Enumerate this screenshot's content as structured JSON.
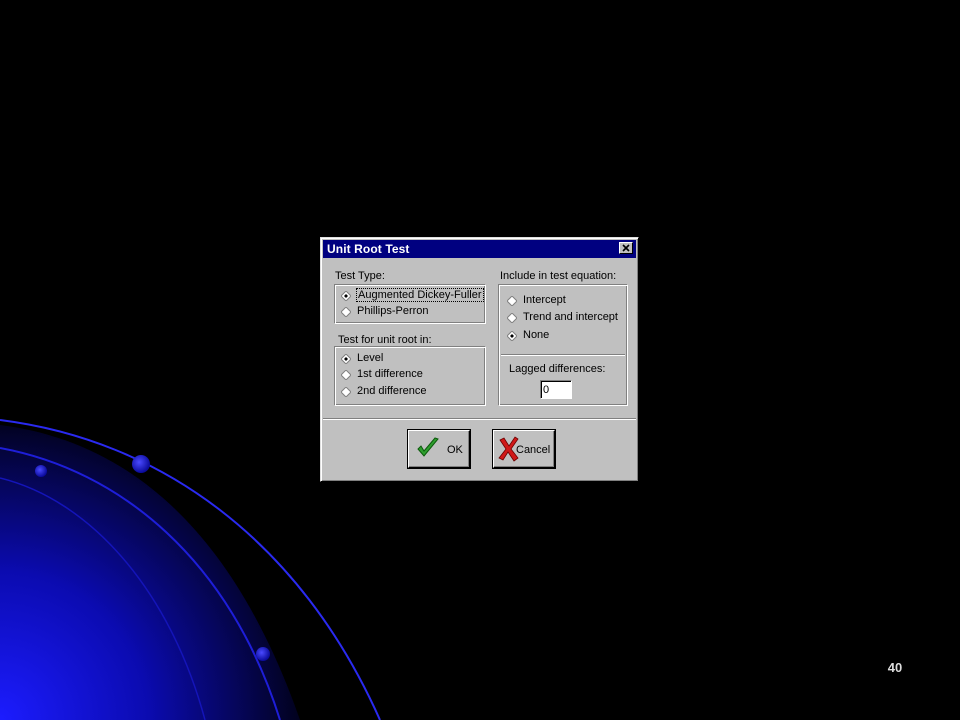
{
  "slide": {
    "page_number": "40"
  },
  "dialog": {
    "title": "Unit Root Test",
    "close_icon": "close-icon",
    "test_type": {
      "label": "Test Type:",
      "options": [
        {
          "label": "Augmented Dickey-Fuller",
          "selected": true
        },
        {
          "label": "Phillips-Perron",
          "selected": false
        }
      ]
    },
    "unit_root_in": {
      "label": "Test for unit root in:",
      "options": [
        {
          "label": "Level",
          "selected": true
        },
        {
          "label": "1st difference",
          "selected": false
        },
        {
          "label": "2nd difference",
          "selected": false
        }
      ]
    },
    "include": {
      "label": "Include in test equation:",
      "options": [
        {
          "label": "Intercept",
          "selected": false
        },
        {
          "label": "Trend and intercept",
          "selected": false
        },
        {
          "label": "None",
          "selected": true
        }
      ]
    },
    "lagged": {
      "label": "Lagged differences:",
      "value": "0"
    },
    "buttons": {
      "ok": {
        "label": "OK",
        "icon": "checkmark-icon"
      },
      "cancel": {
        "label": "Cancel",
        "icon": "cross-icon"
      }
    }
  },
  "colors": {
    "titlebar": "#000080",
    "dialog_face": "#c0c0c0",
    "check_green": "#2e9e2e",
    "cross_red": "#d01818",
    "slide_accent": "#1a1aff"
  }
}
